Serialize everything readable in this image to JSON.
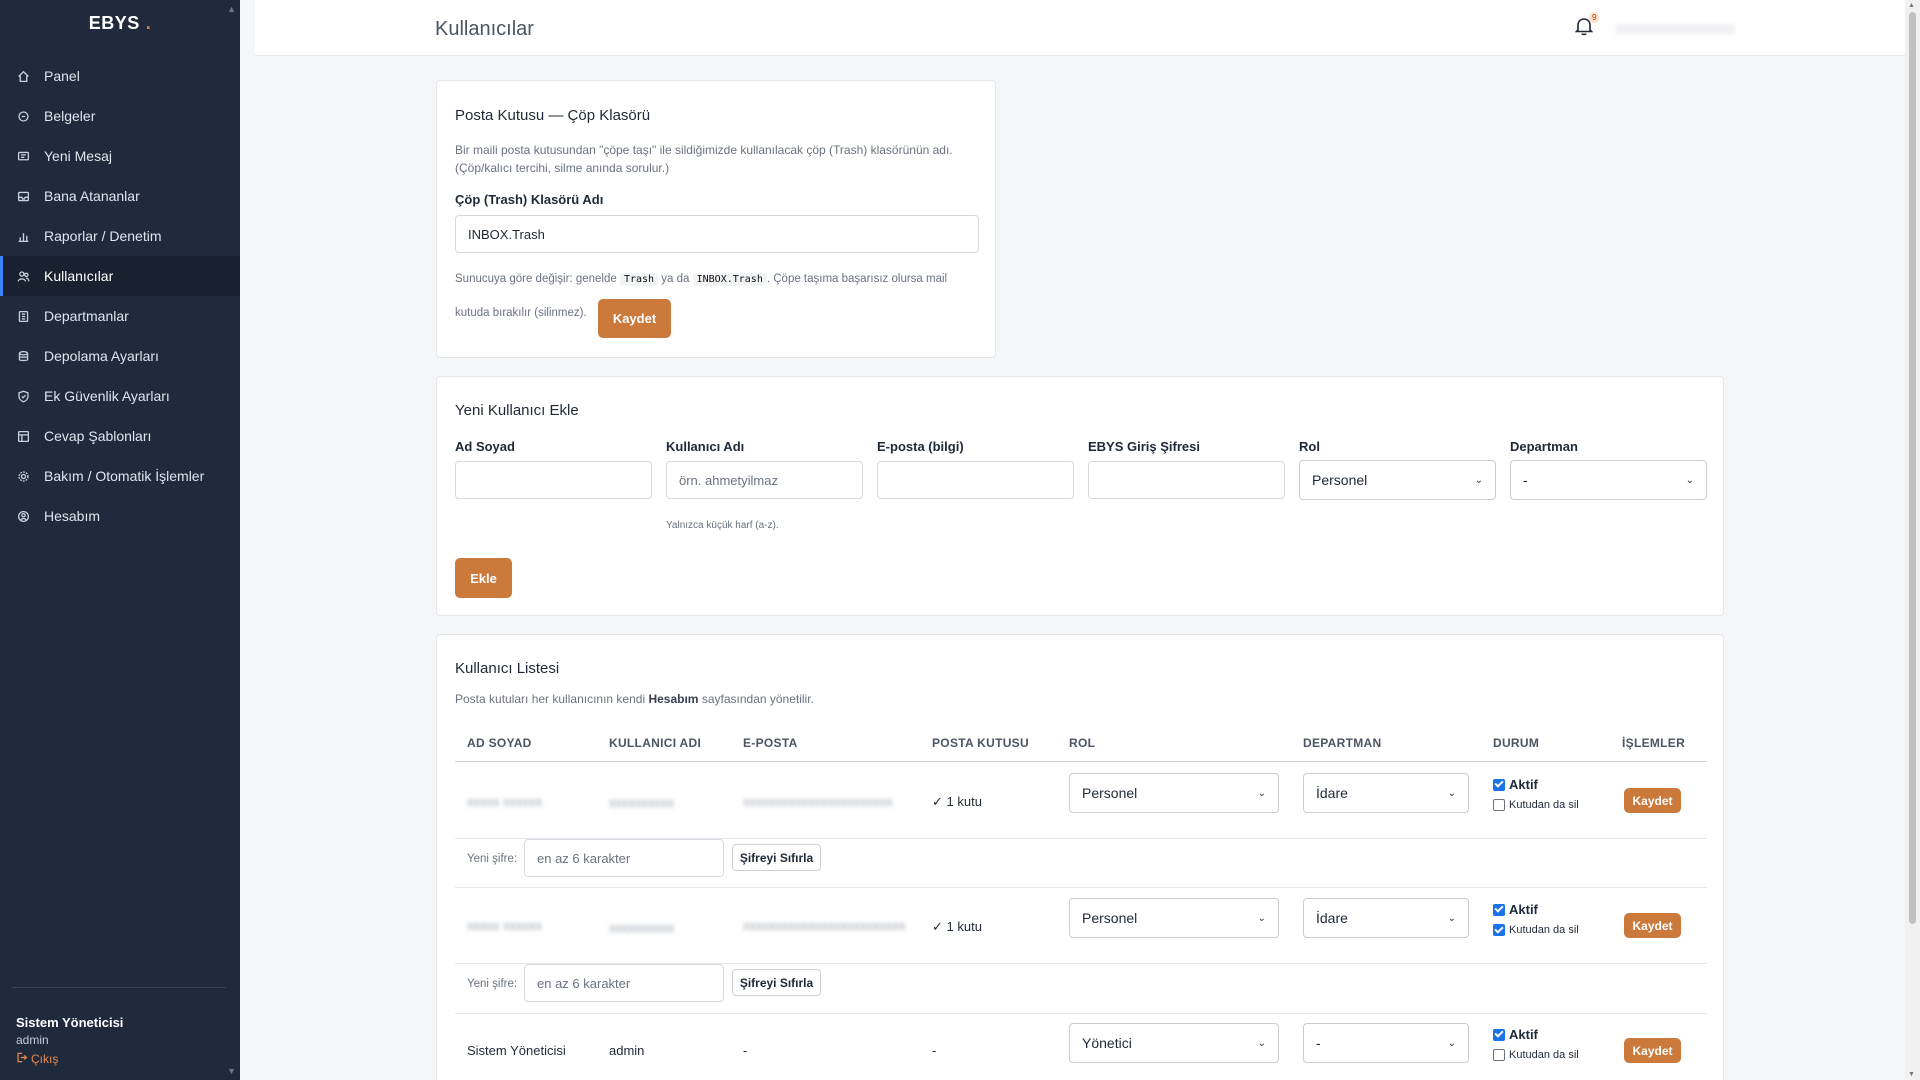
{
  "app": {
    "brand": "EBYS",
    "brand_dot": "."
  },
  "sidebar": {
    "items": [
      {
        "label": "Panel",
        "icon": "home-icon"
      },
      {
        "label": "Belgeler",
        "icon": "document-icon"
      },
      {
        "label": "Yeni Mesaj",
        "icon": "message-icon"
      },
      {
        "label": "Bana Atananlar",
        "icon": "inbox-icon"
      },
      {
        "label": "Raporlar / Denetim",
        "icon": "chart-icon"
      },
      {
        "label": "Kullanıcılar",
        "icon": "users-icon"
      },
      {
        "label": "Departmanlar",
        "icon": "department-icon"
      },
      {
        "label": "Depolama Ayarları",
        "icon": "database-icon"
      },
      {
        "label": "Ek Güvenlik Ayarları",
        "icon": "shield-icon"
      },
      {
        "label": "Cevap Şablonları",
        "icon": "template-icon"
      },
      {
        "label": "Bakım / Otomatik İşlemler",
        "icon": "gear-icon"
      },
      {
        "label": "Hesabım",
        "icon": "account-icon"
      }
    ],
    "active_index": 5,
    "user": {
      "name": "Sistem Yöneticisi",
      "role": "admin",
      "logout": "Çıkış"
    }
  },
  "topbar": {
    "title": "Kullanıcılar",
    "notification_count": "9"
  },
  "trash_card": {
    "title": "Posta Kutusu — Çöp Klasörü",
    "description": "Bir maili posta kutusundan \"çöpe taşı\" ile sildiğimizde kullanılacak çöp (Trash) klasörünün adı. (Çöp/kalıcı tercihi, silme anında sorulur.)",
    "field_label": "Çöp (Trash) Klasörü Adı",
    "field_value": "INBOX.Trash",
    "hint_prefix": "Sunucuya göre değişir: genelde",
    "hint_code1": "Trash",
    "hint_mid": "ya da",
    "hint_code2": "INBOX.Trash",
    "hint_suffix": ". Çöpe taşıma başarısız olursa mail",
    "hint_line2": "kutuda bırakılır (silinmez).",
    "save_label": "Kaydet"
  },
  "new_user": {
    "title": "Yeni Kullanıcı Ekle",
    "fields": {
      "fullname_label": "Ad Soyad",
      "username_label": "Kullanıcı Adı",
      "username_placeholder": "örn. ahmetyilmaz",
      "username_hint": "Yalnızca küçük harf (a-z).",
      "email_label": "E-posta (bilgi)",
      "password_label": "EBYS Giriş Şifresi",
      "role_label": "Rol",
      "role_value": "Personel",
      "department_label": "Departman",
      "department_value": "-"
    },
    "add_label": "Ekle"
  },
  "user_list": {
    "title": "Kullanıcı Listesi",
    "subtitle_prefix": "Posta kutuları her kullanıcının kendi",
    "subtitle_bold": "Hesabım",
    "subtitle_suffix": "sayfasından yönetilir.",
    "columns": [
      "AD SOYAD",
      "KULLANICI ADI",
      "E-POSTA",
      "POSTA KUTUSU",
      "ROL",
      "DEPARTMAN",
      "DURUM",
      "İŞLEMLER"
    ],
    "password_label": "Yeni şifre:",
    "password_placeholder": "en az 6 karakter",
    "reset_label": "Şifreyi Sıfırla",
    "active_label": "Aktif",
    "delete_from_box_label": "Kutudan da sil",
    "save_label": "Kaydet",
    "rows": [
      {
        "name": "",
        "username": "",
        "email": "",
        "mailbox": "✓ 1 kutu",
        "role": "Personel",
        "department": "İdare",
        "active": true,
        "delete_from_box": false
      },
      {
        "name": "",
        "username": "",
        "email": "",
        "mailbox": "✓ 1 kutu",
        "role": "Personel",
        "department": "İdare",
        "active": true,
        "delete_from_box": true
      },
      {
        "name": "Sistem Yöneticisi",
        "username": "admin",
        "email": "-",
        "mailbox": "-",
        "role": "Yönetici",
        "department": "-",
        "active": true,
        "delete_from_box": false
      }
    ]
  },
  "colors": {
    "accent": "#cc7a3c",
    "sidebar": "#1f2b3d",
    "active_marker": "#3b82f6"
  }
}
